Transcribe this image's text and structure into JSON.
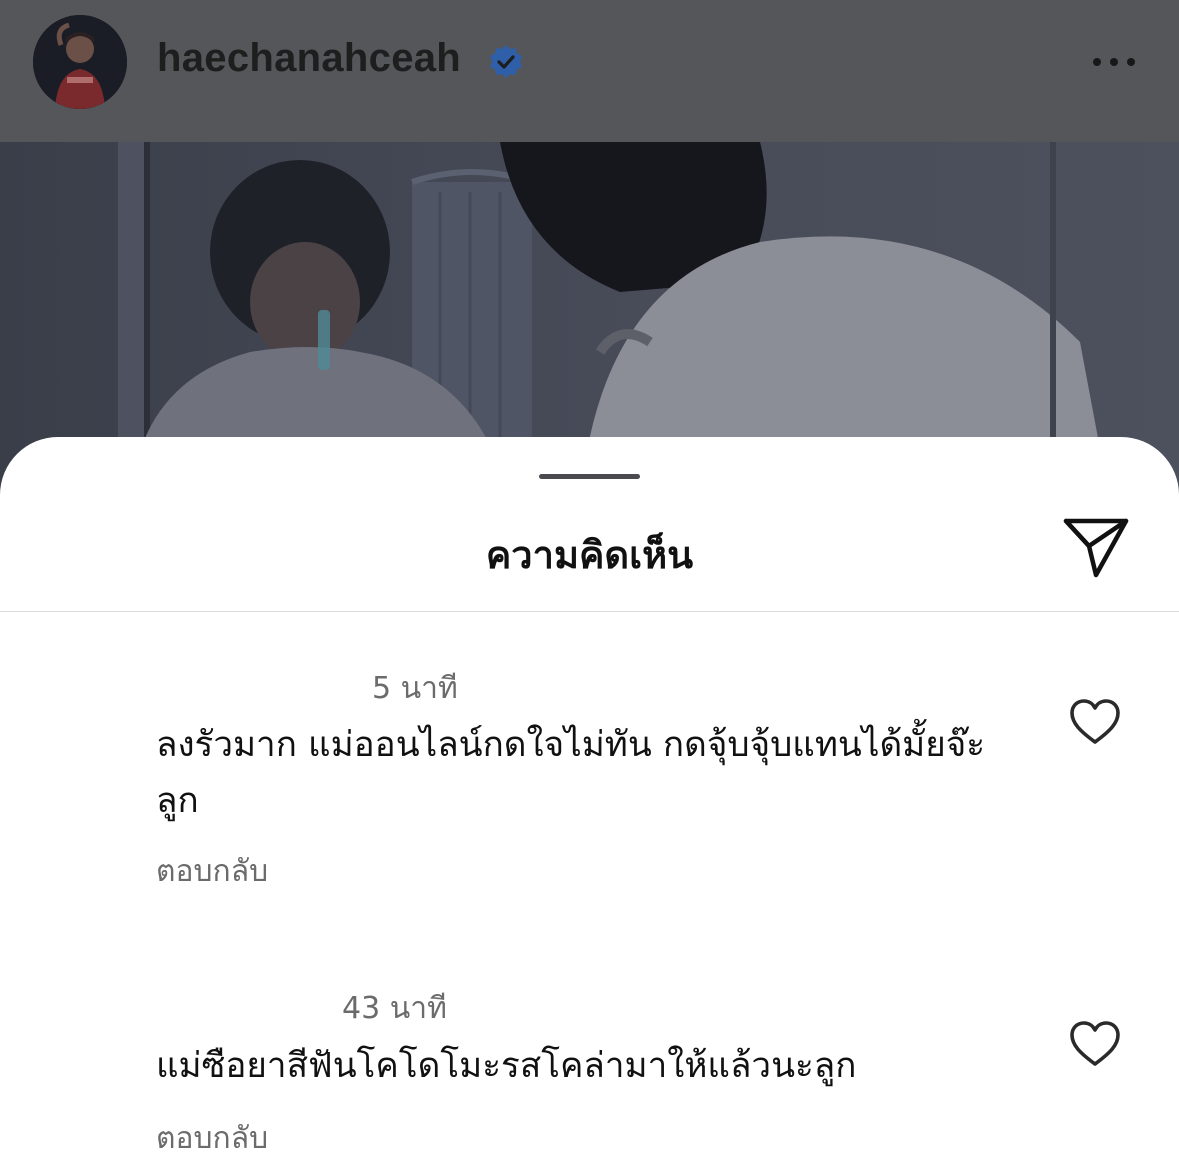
{
  "post": {
    "username": "haechanahceah",
    "verified": true,
    "avatar_icon": "user-avatar",
    "more_icon": "more-options-icon"
  },
  "comments_sheet": {
    "title": "ความคิดเห็น",
    "share_icon": "paper-plane-icon"
  },
  "comments": [
    {
      "time": "5 นาที",
      "text": "ลงรัวมาก แม่ออนไลน์กดใจไม่ทัน กดจุ้บจุ้บแทนได้มั้ยจ๊ะลูก",
      "reply_label": "ตอบกลับ",
      "like_icon": "heart-outline-icon"
    },
    {
      "time": "43 นาที",
      "text": "แม่ซือยาสีฟันโคโดโมะรสโคล่ามาให้แล้วนะลูก",
      "reply_label": "ตอบกลับ",
      "like_icon": "heart-outline-icon"
    }
  ],
  "colors": {
    "dim_header": "#545659",
    "verified_badge": "#2f5fa8",
    "sheet_background": "#ffffff",
    "secondary_text": "#6b6b6b"
  }
}
